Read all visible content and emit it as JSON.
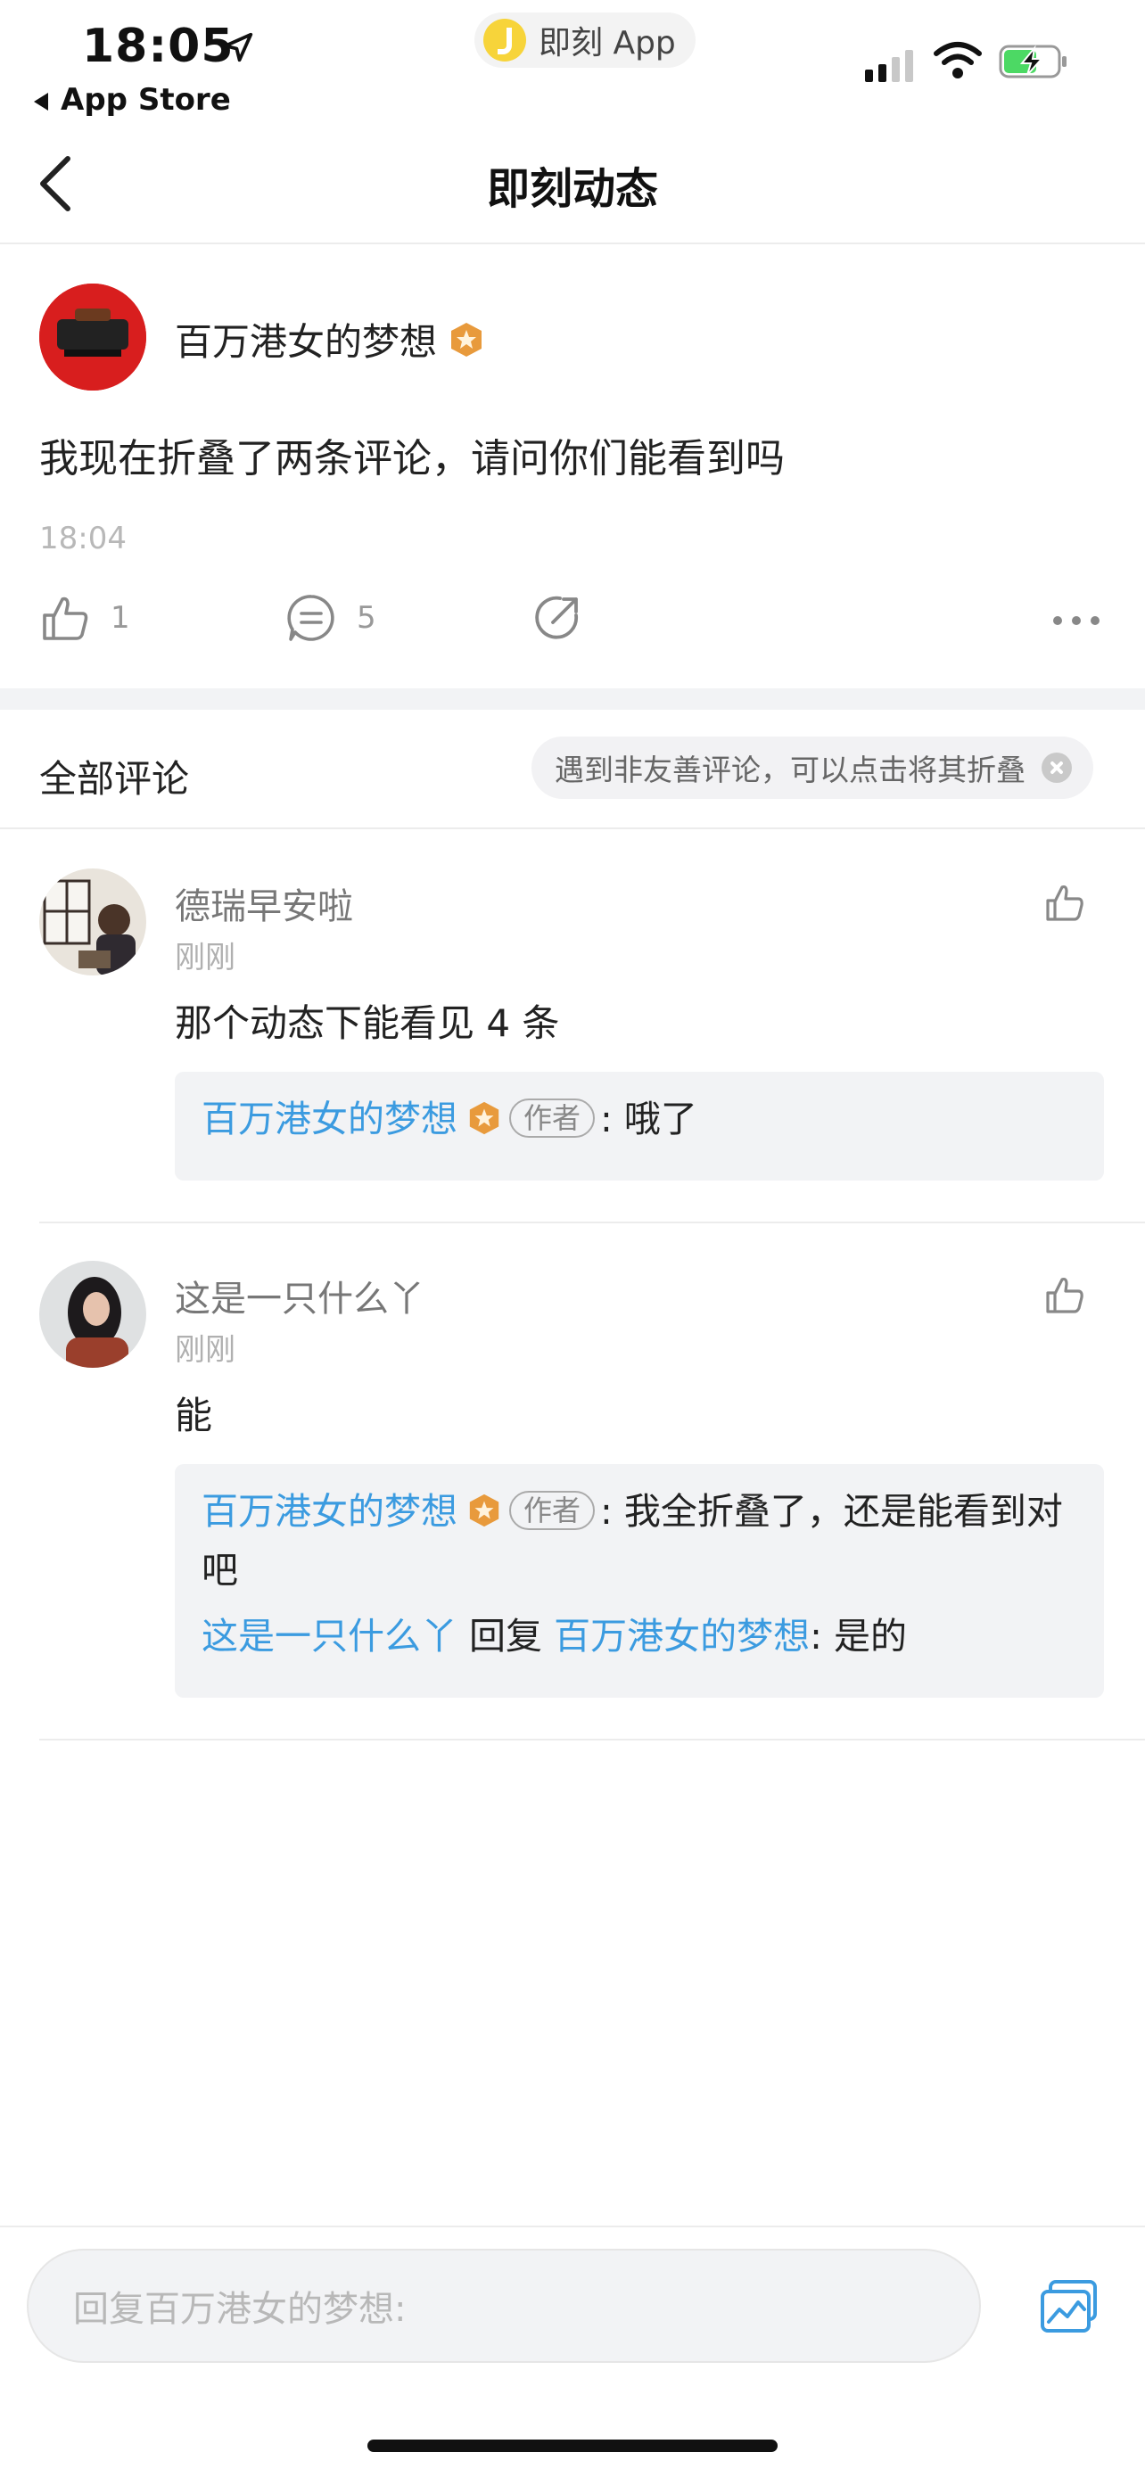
{
  "status_bar": {
    "time": "18:05",
    "back_label": "App Store",
    "app_pill": "即刻 App"
  },
  "nav": {
    "title": "即刻动态"
  },
  "post": {
    "username": "百万港女的梦想",
    "text": "我现在折叠了两条评论，请问你们能看到吗",
    "time": "18:04",
    "like_count": "1",
    "comment_count": "5"
  },
  "comments_header": {
    "title": "全部评论",
    "tip": "遇到非友善评论，可以点击将其折叠"
  },
  "comments": [
    {
      "username": "德瑞早安啦",
      "time": "刚刚",
      "text": "那个动态下能看见 4 条",
      "replies": [
        {
          "author": "百万港女的梦想",
          "tag": "作者",
          "text": ": 哦了"
        }
      ]
    },
    {
      "username": "这是一只什么丫",
      "time": "刚刚",
      "text": "能",
      "replies": [
        {
          "author": "百万港女的梦想",
          "tag": "作者",
          "text": ": 我全折叠了，还是能看到对吧"
        },
        {
          "author": "这是一只什么丫",
          "reply_word": "回复",
          "target": "百万港女的梦想",
          "text": ": 是的"
        }
      ]
    }
  ],
  "composer": {
    "placeholder": "回复百万港女的梦想:"
  },
  "colors": {
    "link_blue": "#3b9be0",
    "badge_orange": "#e89a3c"
  }
}
